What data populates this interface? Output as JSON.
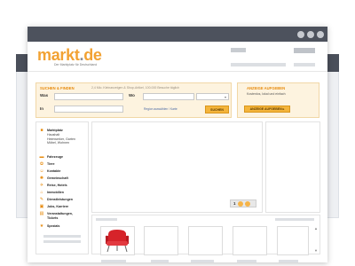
{
  "brand": {
    "logo_left": "markt",
    "logo_dot": ".",
    "logo_right": "de",
    "tagline": "Der Marktplatz für Deutschland"
  },
  "search": {
    "title": "SUCHEN & FINDEN",
    "subtitle": "2,4 Mio. Kleinanzeigen & Shop-Artikel, 100.000 Besuche täglich",
    "was_label": "Was",
    "wo_label": "Wo",
    "in_label": "In",
    "was_value": "",
    "wo_value": "",
    "in_value": "",
    "region_link": "Region auswählen / Karte",
    "button": "SUCHEN"
  },
  "ad": {
    "title": "ANZEIGE AUFGEBEN",
    "subtitle": "Kostenlos, lokal und einfach",
    "button": "ANZEIGE AUFGEBEN ▸"
  },
  "categories": [
    {
      "label": "Marktplatz",
      "sub": "Haushalt\nHeimwerker, Garten\nMöbel, Wohnen",
      "icon": "marketplace-icon"
    },
    {
      "label": "Fahrzeuge",
      "icon": "car-icon"
    },
    {
      "label": "Tiere",
      "icon": "paw-icon"
    },
    {
      "label": "Kontakte",
      "icon": "contacts-icon"
    },
    {
      "label": "Gemeinschaft",
      "icon": "community-icon"
    },
    {
      "label": "Reise, Hotels",
      "icon": "travel-icon"
    },
    {
      "label": "Immobilien",
      "icon": "house-icon"
    },
    {
      "label": "Dienstleistungen",
      "icon": "services-icon"
    },
    {
      "label": "Jobs, Karriere",
      "icon": "briefcase-icon"
    },
    {
      "label": "Veranstaltungen, Tickets",
      "icon": "ticket-icon"
    },
    {
      "label": "Spezials",
      "icon": "star-icon"
    }
  ],
  "pager": {
    "current": "1"
  },
  "colors": {
    "accent": "#f2a233",
    "header_bar": "#4d525d",
    "panel_bg": "#fdf3df"
  }
}
